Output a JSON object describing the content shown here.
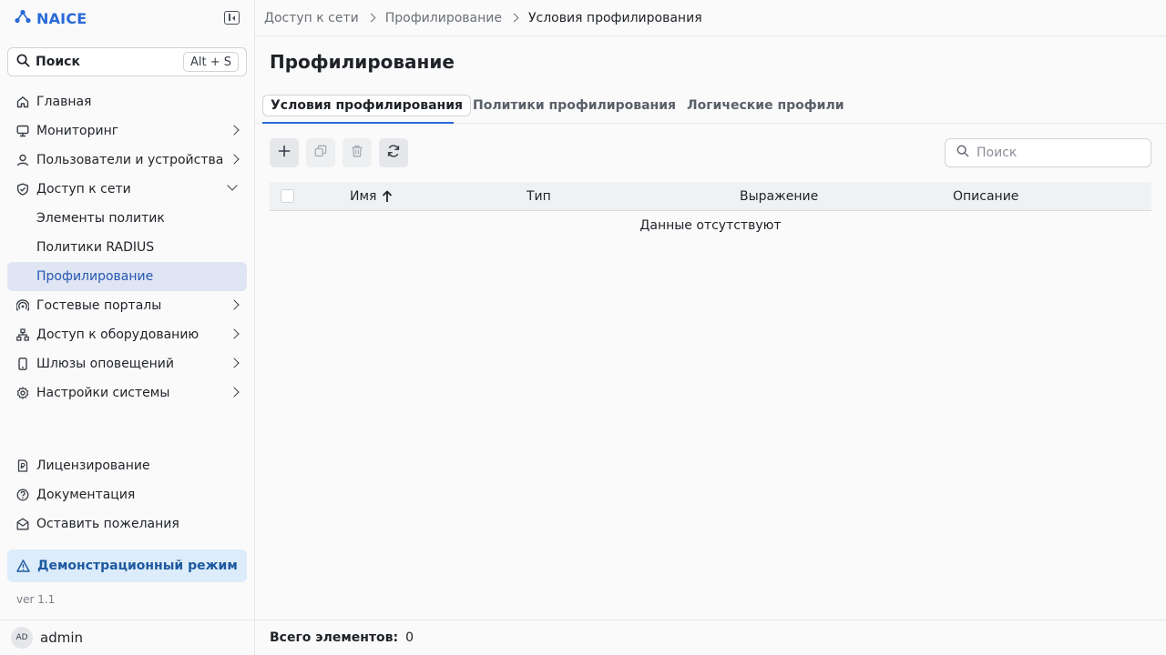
{
  "brand": {
    "name": "NAICE",
    "accent": "#2a6ad8"
  },
  "sidebar": {
    "search": {
      "label": "Поиск",
      "shortcut": "Alt + S"
    },
    "items": [
      {
        "label": "Главная",
        "icon": "home-icon"
      },
      {
        "label": "Мониторинг",
        "icon": "monitor-icon"
      },
      {
        "label": "Пользователи и устройства",
        "icon": "user-icon"
      },
      {
        "label": "Доступ к сети",
        "icon": "shield-icon"
      },
      {
        "label": "Элементы политик"
      },
      {
        "label": "Политики RADIUS"
      },
      {
        "label": "Профилирование"
      },
      {
        "label": "Гостевые порталы",
        "icon": "radio-icon"
      },
      {
        "label": "Доступ к оборудованию",
        "icon": "network-icon"
      },
      {
        "label": "Шлюзы оповещений",
        "icon": "phone-icon"
      },
      {
        "label": "Настройки системы",
        "icon": "gear-icon"
      }
    ],
    "bottom": [
      {
        "label": "Лицензирование",
        "icon": "license-icon"
      },
      {
        "label": "Документация",
        "icon": "help-icon"
      },
      {
        "label": "Оставить пожелания",
        "icon": "mail-icon"
      }
    ],
    "demo": "Демонстрационный режим",
    "version": "ver 1.1",
    "user": {
      "initials": "AD",
      "name": "admin"
    }
  },
  "breadcrumb": [
    "Доступ к сети",
    "Профилирование",
    "Условия профилирования"
  ],
  "page": {
    "title": "Профилирование"
  },
  "tabs": [
    "Условия профилирования",
    "Политики профилирования",
    "Логические профили"
  ],
  "table": {
    "search_placeholder": "Поиск",
    "columns": [
      "Имя",
      "Тип",
      "Выражение",
      "Описание"
    ],
    "empty": "Данные отсутствуют"
  },
  "footer": {
    "label": "Всего элементов:",
    "count": "0"
  }
}
